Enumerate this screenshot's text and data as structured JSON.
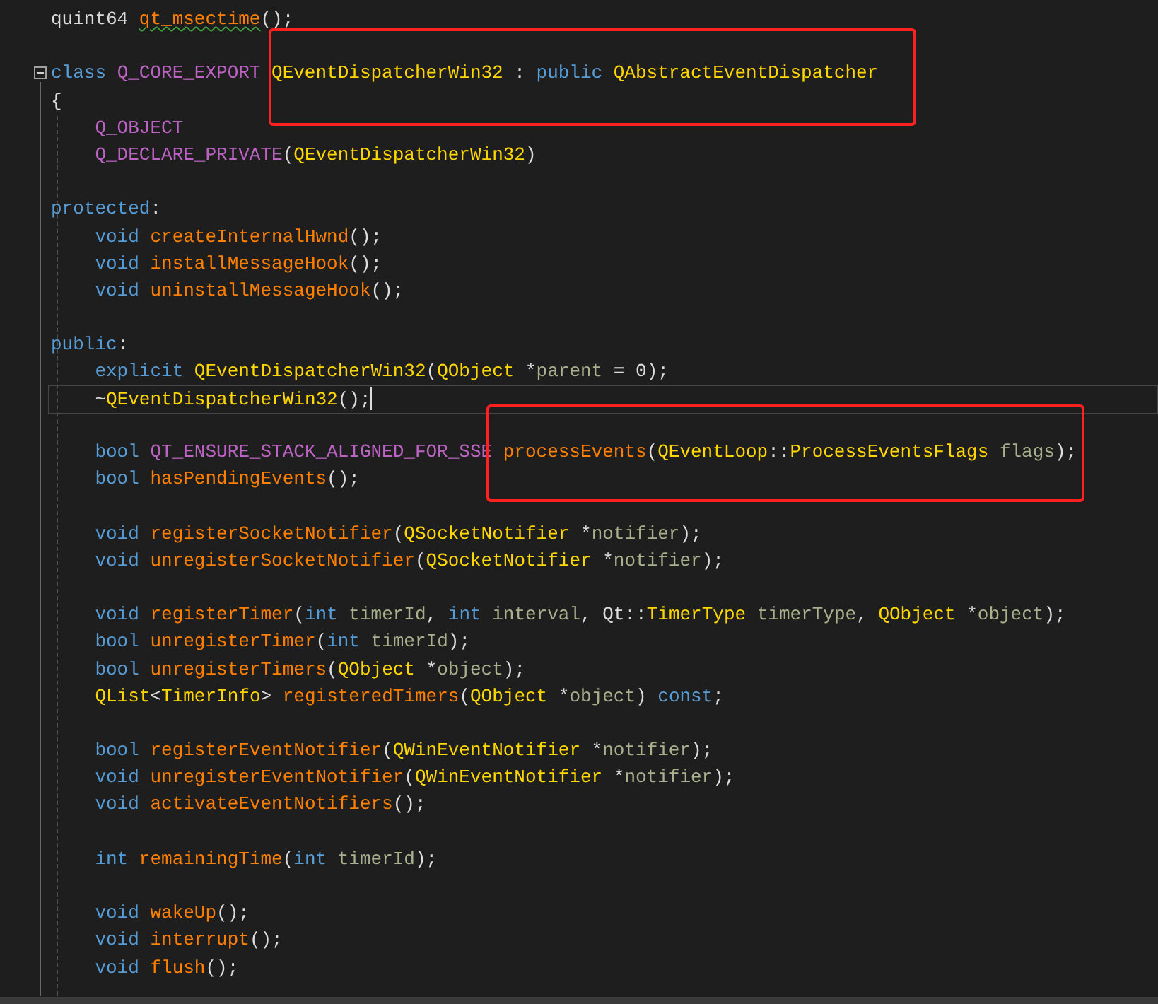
{
  "editor": {
    "lines": [
      {
        "kind": "code",
        "tokens": [
          {
            "text": "quint64 ",
            "kind": "plain"
          },
          {
            "text": "qt_msectime",
            "kind": "func",
            "error": true
          },
          {
            "text": "();",
            "kind": "plain"
          }
        ]
      },
      {
        "kind": "blank"
      },
      {
        "kind": "code",
        "foldable": true,
        "tokens": [
          {
            "text": "class ",
            "kind": "kw"
          },
          {
            "text": "Q_CORE_EXPORT ",
            "kind": "macro"
          },
          {
            "text": "QEventDispatcherWin32",
            "kind": "type"
          },
          {
            "text": " : ",
            "kind": "plain"
          },
          {
            "text": "public ",
            "kind": "kw"
          },
          {
            "text": "QAbstractEventDispatcher",
            "kind": "type"
          }
        ]
      },
      {
        "kind": "code",
        "tokens": [
          {
            "text": "{",
            "kind": "plain"
          }
        ]
      },
      {
        "kind": "code",
        "tokens": [
          {
            "text": "    Q_OBJECT",
            "kind": "macro"
          }
        ]
      },
      {
        "kind": "code",
        "tokens": [
          {
            "text": "    Q_DECLARE_PRIVATE",
            "kind": "macro"
          },
          {
            "text": "(",
            "kind": "plain"
          },
          {
            "text": "QEventDispatcherWin32",
            "kind": "type"
          },
          {
            "text": ")",
            "kind": "plain"
          }
        ]
      },
      {
        "kind": "blank"
      },
      {
        "kind": "code",
        "tokens": [
          {
            "text": "protected",
            "kind": "kw"
          },
          {
            "text": ":",
            "kind": "plain"
          }
        ]
      },
      {
        "kind": "code",
        "tokens": [
          {
            "text": "    void",
            "kind": "kw"
          },
          {
            "text": " createInternalHwnd",
            "kind": "func"
          },
          {
            "text": "();",
            "kind": "plain"
          }
        ]
      },
      {
        "kind": "code",
        "tokens": [
          {
            "text": "    void",
            "kind": "kw"
          },
          {
            "text": " installMessageHook",
            "kind": "func"
          },
          {
            "text": "();",
            "kind": "plain"
          }
        ]
      },
      {
        "kind": "code",
        "tokens": [
          {
            "text": "    void",
            "kind": "kw"
          },
          {
            "text": " uninstallMessageHook",
            "kind": "func"
          },
          {
            "text": "();",
            "kind": "plain"
          }
        ]
      },
      {
        "kind": "blank"
      },
      {
        "kind": "code",
        "tokens": [
          {
            "text": "public",
            "kind": "kw"
          },
          {
            "text": ":",
            "kind": "plain"
          }
        ]
      },
      {
        "kind": "code",
        "tokens": [
          {
            "text": "    explicit",
            "kind": "kw"
          },
          {
            "text": " QEventDispatcherWin32",
            "kind": "type"
          },
          {
            "text": "(",
            "kind": "plain"
          },
          {
            "text": "QObject",
            "kind": "type"
          },
          {
            "text": " *",
            "kind": "plain"
          },
          {
            "text": "parent",
            "kind": "param"
          },
          {
            "text": " = 0);",
            "kind": "plain"
          }
        ]
      },
      {
        "kind": "code",
        "current": true,
        "tokens": [
          {
            "text": "    ~",
            "kind": "plain"
          },
          {
            "text": "QEventDispatcherWin32",
            "kind": "type"
          },
          {
            "text": "();",
            "kind": "plain"
          }
        ]
      },
      {
        "kind": "blank"
      },
      {
        "kind": "code",
        "tokens": [
          {
            "text": "    bool",
            "kind": "kw"
          },
          {
            "text": " QT_ENSURE_STACK_ALIGNED_FOR_SSE",
            "kind": "macro"
          },
          {
            "text": " processEvents",
            "kind": "func"
          },
          {
            "text": "(",
            "kind": "plain"
          },
          {
            "text": "QEventLoop",
            "kind": "type"
          },
          {
            "text": "::",
            "kind": "plain"
          },
          {
            "text": "ProcessEventsFlags ",
            "kind": "type"
          },
          {
            "text": "flags",
            "kind": "param"
          },
          {
            "text": ");",
            "kind": "plain"
          }
        ]
      },
      {
        "kind": "code",
        "tokens": [
          {
            "text": "    bool",
            "kind": "kw"
          },
          {
            "text": " hasPendingEvents",
            "kind": "func"
          },
          {
            "text": "();",
            "kind": "plain"
          }
        ]
      },
      {
        "kind": "blank"
      },
      {
        "kind": "code",
        "tokens": [
          {
            "text": "    void",
            "kind": "kw"
          },
          {
            "text": " registerSocketNotifier",
            "kind": "func"
          },
          {
            "text": "(",
            "kind": "plain"
          },
          {
            "text": "QSocketNotifier",
            "kind": "type"
          },
          {
            "text": " *",
            "kind": "plain"
          },
          {
            "text": "notifier",
            "kind": "param"
          },
          {
            "text": ");",
            "kind": "plain"
          }
        ]
      },
      {
        "kind": "code",
        "tokens": [
          {
            "text": "    void",
            "kind": "kw"
          },
          {
            "text": " unregisterSocketNotifier",
            "kind": "func"
          },
          {
            "text": "(",
            "kind": "plain"
          },
          {
            "text": "QSocketNotifier",
            "kind": "type"
          },
          {
            "text": " *",
            "kind": "plain"
          },
          {
            "text": "notifier",
            "kind": "param"
          },
          {
            "text": ");",
            "kind": "plain"
          }
        ]
      },
      {
        "kind": "blank"
      },
      {
        "kind": "code",
        "tokens": [
          {
            "text": "    void",
            "kind": "kw"
          },
          {
            "text": " registerTimer",
            "kind": "func"
          },
          {
            "text": "(",
            "kind": "plain"
          },
          {
            "text": "int ",
            "kind": "kw"
          },
          {
            "text": "timerId",
            "kind": "param"
          },
          {
            "text": ", ",
            "kind": "plain"
          },
          {
            "text": "int ",
            "kind": "kw"
          },
          {
            "text": "interval",
            "kind": "param"
          },
          {
            "text": ", Qt::",
            "kind": "plain"
          },
          {
            "text": "TimerType ",
            "kind": "type"
          },
          {
            "text": "timerType",
            "kind": "param"
          },
          {
            "text": ", ",
            "kind": "plain"
          },
          {
            "text": "QObject",
            "kind": "type"
          },
          {
            "text": " *",
            "kind": "plain"
          },
          {
            "text": "object",
            "kind": "param"
          },
          {
            "text": ");",
            "kind": "plain"
          }
        ]
      },
      {
        "kind": "code",
        "tokens": [
          {
            "text": "    bool",
            "kind": "kw"
          },
          {
            "text": " unregisterTimer",
            "kind": "func"
          },
          {
            "text": "(",
            "kind": "plain"
          },
          {
            "text": "int ",
            "kind": "kw"
          },
          {
            "text": "timerId",
            "kind": "param"
          },
          {
            "text": ");",
            "kind": "plain"
          }
        ]
      },
      {
        "kind": "code",
        "tokens": [
          {
            "text": "    bool",
            "kind": "kw"
          },
          {
            "text": " unregisterTimers",
            "kind": "func"
          },
          {
            "text": "(",
            "kind": "plain"
          },
          {
            "text": "QObject",
            "kind": "type"
          },
          {
            "text": " *",
            "kind": "plain"
          },
          {
            "text": "object",
            "kind": "param"
          },
          {
            "text": ");",
            "kind": "plain"
          }
        ]
      },
      {
        "kind": "code",
        "tokens": [
          {
            "text": "    QList",
            "kind": "type"
          },
          {
            "text": "<",
            "kind": "plain"
          },
          {
            "text": "TimerInfo",
            "kind": "type"
          },
          {
            "text": ">",
            "kind": "plain"
          },
          {
            "text": " registeredTimers",
            "kind": "func"
          },
          {
            "text": "(",
            "kind": "plain"
          },
          {
            "text": "QObject",
            "kind": "type"
          },
          {
            "text": " *",
            "kind": "plain"
          },
          {
            "text": "object",
            "kind": "param"
          },
          {
            "text": ") ",
            "kind": "plain"
          },
          {
            "text": "const",
            "kind": "kw"
          },
          {
            "text": ";",
            "kind": "plain"
          }
        ]
      },
      {
        "kind": "blank"
      },
      {
        "kind": "code",
        "tokens": [
          {
            "text": "    bool",
            "kind": "kw"
          },
          {
            "text": " registerEventNotifier",
            "kind": "func"
          },
          {
            "text": "(",
            "kind": "plain"
          },
          {
            "text": "QWinEventNotifier",
            "kind": "type"
          },
          {
            "text": " *",
            "kind": "plain"
          },
          {
            "text": "notifier",
            "kind": "param"
          },
          {
            "text": ");",
            "kind": "plain"
          }
        ]
      },
      {
        "kind": "code",
        "tokens": [
          {
            "text": "    void",
            "kind": "kw"
          },
          {
            "text": " unregisterEventNotifier",
            "kind": "func"
          },
          {
            "text": "(",
            "kind": "plain"
          },
          {
            "text": "QWinEventNotifier",
            "kind": "type"
          },
          {
            "text": " *",
            "kind": "plain"
          },
          {
            "text": "notifier",
            "kind": "param"
          },
          {
            "text": ");",
            "kind": "plain"
          }
        ]
      },
      {
        "kind": "code",
        "tokens": [
          {
            "text": "    void",
            "kind": "kw"
          },
          {
            "text": " activateEventNotifiers",
            "kind": "func"
          },
          {
            "text": "();",
            "kind": "plain"
          }
        ]
      },
      {
        "kind": "blank"
      },
      {
        "kind": "code",
        "tokens": [
          {
            "text": "    int",
            "kind": "kw"
          },
          {
            "text": " remainingTime",
            "kind": "func"
          },
          {
            "text": "(",
            "kind": "plain"
          },
          {
            "text": "int ",
            "kind": "kw"
          },
          {
            "text": "timerId",
            "kind": "param"
          },
          {
            "text": ");",
            "kind": "plain"
          }
        ]
      },
      {
        "kind": "blank"
      },
      {
        "kind": "code",
        "tokens": [
          {
            "text": "    void",
            "kind": "kw"
          },
          {
            "text": " wakeUp",
            "kind": "func"
          },
          {
            "text": "();",
            "kind": "plain"
          }
        ]
      },
      {
        "kind": "code",
        "tokens": [
          {
            "text": "    void",
            "kind": "kw"
          },
          {
            "text": " interrupt",
            "kind": "func"
          },
          {
            "text": "();",
            "kind": "plain"
          }
        ]
      },
      {
        "kind": "code",
        "tokens": [
          {
            "text": "    void",
            "kind": "kw"
          },
          {
            "text": " flush",
            "kind": "func"
          },
          {
            "text": "();",
            "kind": "plain"
          }
        ]
      }
    ]
  },
  "annotations": [
    {
      "kind": "red-box"
    },
    {
      "kind": "red-box"
    }
  ]
}
